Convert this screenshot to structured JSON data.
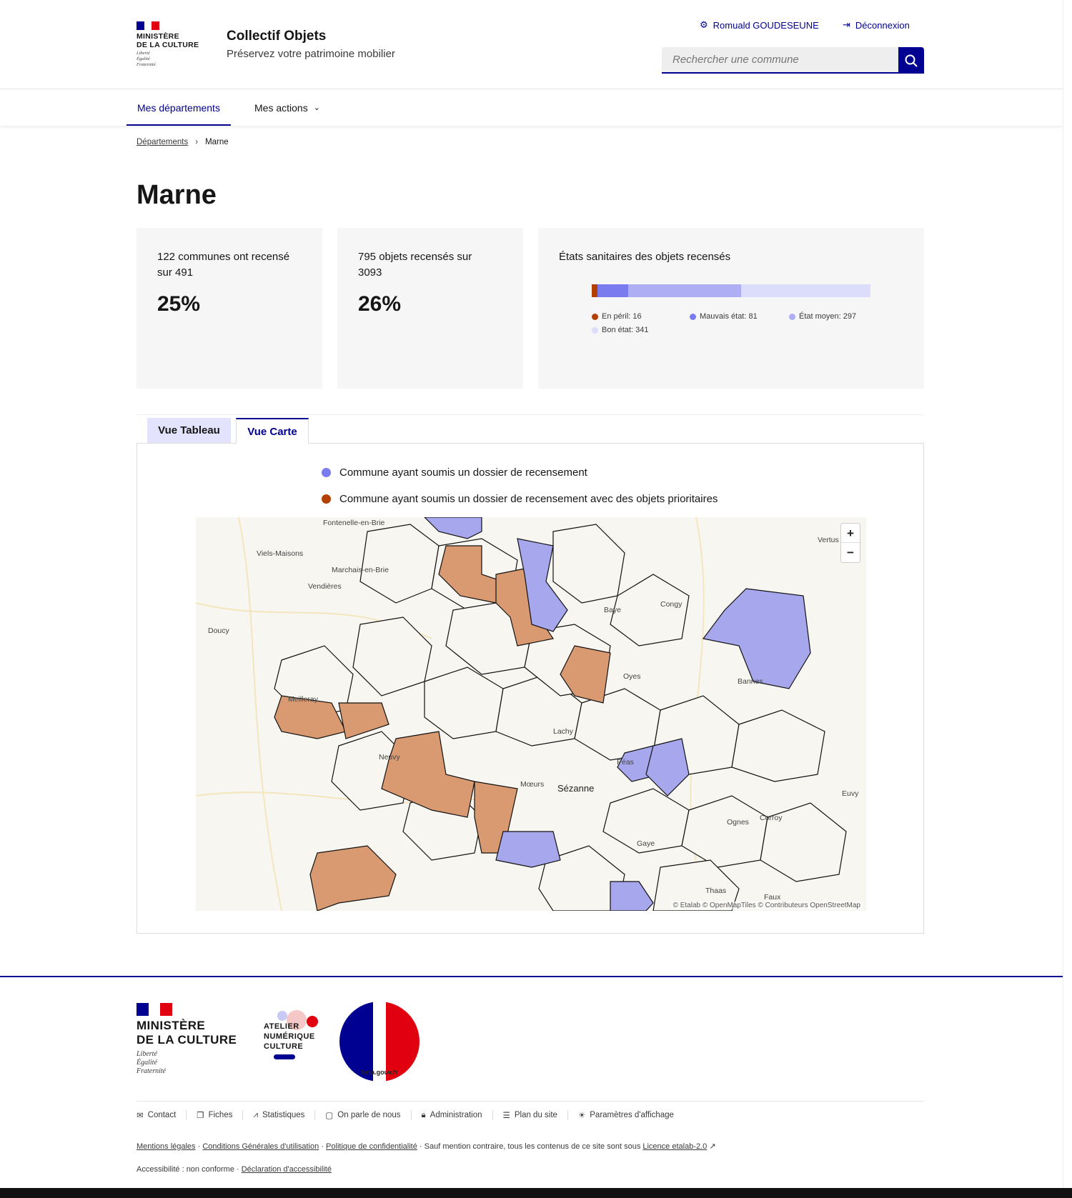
{
  "header": {
    "ministry_lines": [
      "MINISTÈRE",
      "DE LA CULTURE"
    ],
    "motto": [
      "Liberté",
      "Égalité",
      "Fraternité"
    ],
    "site_title": "Collectif Objets",
    "tagline": "Préservez votre patrimoine mobilier",
    "user_name": "Romuald GOUDESEUNE",
    "logout_label": "Déconnexion",
    "search_placeholder": "Rechercher une commune"
  },
  "nav": {
    "items": [
      {
        "label": "Mes départements"
      },
      {
        "label": "Mes actions"
      }
    ]
  },
  "breadcrumb": {
    "parent": "Départements",
    "current": "Marne"
  },
  "page_title": "Marne",
  "stats": {
    "communes": {
      "label": "122 communes ont recensé sur 491",
      "percent": "25%"
    },
    "objets": {
      "label": "795 objets recensés sur 3093",
      "percent": "26%"
    },
    "etats": {
      "title": "États sanitaires des objets recensés",
      "segments": [
        {
          "label": "En péril: 16",
          "value": 16,
          "color": "#b34000"
        },
        {
          "label": "Mauvais état: 81",
          "value": 81,
          "color": "#7b7bf0"
        },
        {
          "label": "État moyen: 297",
          "value": 297,
          "color": "#aeaef5"
        },
        {
          "label": "Bon état: 341",
          "value": 341,
          "color": "#dcdcfb"
        }
      ]
    }
  },
  "tabs": [
    {
      "label": "Vue Tableau"
    },
    {
      "label": "Vue Carte"
    }
  ],
  "map": {
    "legend": [
      {
        "label": "Commune ayant soumis un dossier de recensement",
        "color": "#7b7bf0"
      },
      {
        "label": "Commune ayant soumis un dossier de recensement avec des objets prioritaires",
        "color": "#b34000"
      }
    ],
    "places": [
      "Fontenelle-en-Brie",
      "Viels-Maisons",
      "Marchais-en-Brie",
      "Vendières",
      "Doucy",
      "Baye",
      "Congy",
      "Vertus",
      "Bannes",
      "Oyes",
      "Meilleray",
      "Lachy",
      "Neuvy",
      "Péas",
      "Mœurs",
      "Sézanne",
      "Euvy",
      "Ognes",
      "Corroy",
      "Gaye",
      "Thaas",
      "Faux"
    ],
    "zoom_in": "+",
    "zoom_out": "−",
    "attribution": "© Etalab  © OpenMapTiles  © Contributeurs OpenStreetMap"
  },
  "footer": {
    "ministry_lines": [
      "MINISTÈRE",
      "DE LA CULTURE"
    ],
    "motto": [
      "Liberté",
      "Égalité",
      "Fraternité"
    ],
    "atelier_lines": [
      "ATELIER",
      "NUMÉRIQUE",
      "CULTURE"
    ],
    "beta_text": "beta.gouv.fr",
    "links": [
      "Contact",
      "Fiches",
      "Statistiques",
      "On parle de nous",
      "Administration",
      "Plan du site",
      "Paramètres d'affichage"
    ],
    "legal": {
      "mentions": "Mentions légales",
      "cgu": "Conditions Générales d'utilisation",
      "confidentialite": "Politique de confidentialité",
      "sauf": "Sauf mention contraire, tous les contenus de ce site sont sous",
      "licence": "Licence etalab-2.0"
    },
    "accessibility": {
      "status": "Accessibilité : non conforme",
      "declaration": "Déclaration d'accessibilité"
    }
  }
}
